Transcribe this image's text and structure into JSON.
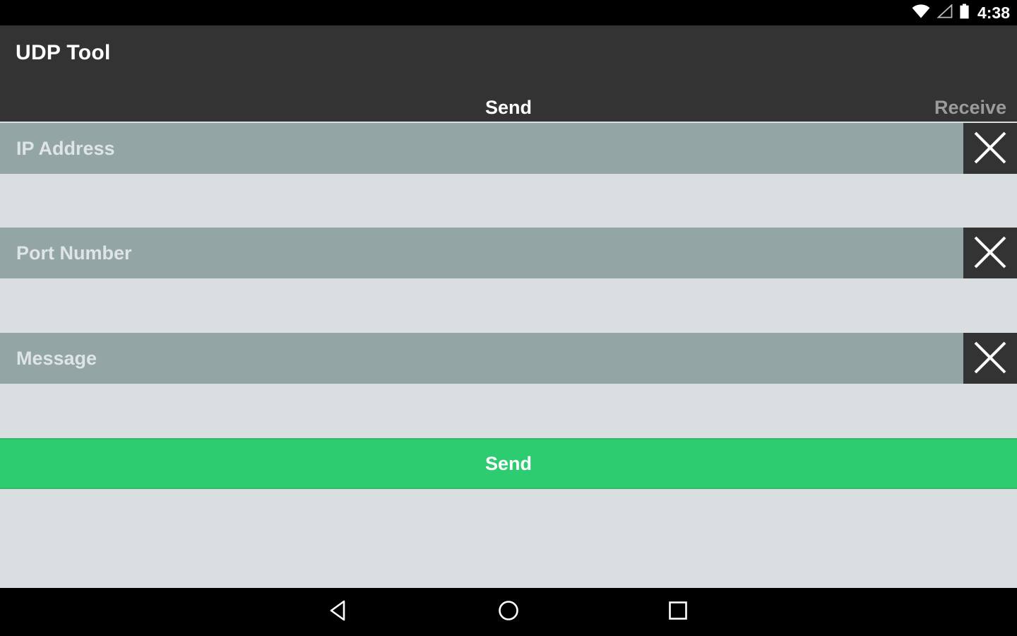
{
  "status_bar": {
    "time": "4:38",
    "icons": [
      {
        "name": "wifi-icon",
        "glyph": "wifi"
      },
      {
        "name": "cell-signal-icon",
        "glyph": "signal-triangle"
      },
      {
        "name": "battery-icon",
        "glyph": "battery-full"
      }
    ]
  },
  "action_bar": {
    "title": "UDP Tool",
    "background": "#333333"
  },
  "tabs": [
    {
      "label": "Send",
      "active": true
    },
    {
      "label": "Receive",
      "active": false
    }
  ],
  "form": {
    "fields": [
      {
        "name": "ip-address",
        "placeholder": "IP Address",
        "value": "",
        "clear_icon": "close-icon"
      },
      {
        "name": "port-number",
        "placeholder": "Port Number",
        "value": "",
        "clear_icon": "close-icon"
      },
      {
        "name": "message",
        "placeholder": "Message",
        "value": "",
        "clear_icon": "close-icon"
      }
    ],
    "submit_label": "Send"
  },
  "nav_bar": {
    "buttons": [
      {
        "name": "back-button",
        "icon": "back-triangle-icon"
      },
      {
        "name": "home-button",
        "icon": "home-circle-icon"
      },
      {
        "name": "recents-button",
        "icon": "recents-square-icon"
      }
    ]
  },
  "colors": {
    "accent_green": "#2ecc71",
    "field_gray": "#94a5a6",
    "page_background": "#d9dfe1",
    "bar_dark": "#333333",
    "system_black": "#000000",
    "inactive_tab": "#9b9b9b"
  }
}
